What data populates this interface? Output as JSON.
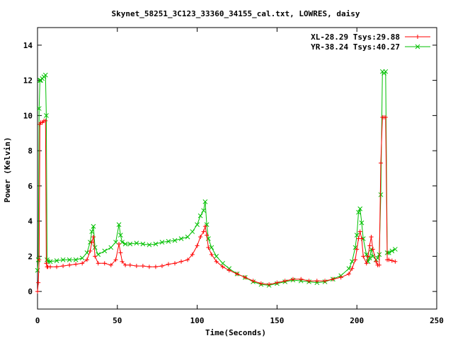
{
  "chart_data": {
    "type": "line",
    "title": "Skynet_58251_3C123_33360_34155_cal.txt, LOWRES, daisy",
    "xlabel": "Time(Seconds)",
    "ylabel": "Power (Kelvin)",
    "xlim": [
      0,
      250
    ],
    "ylim": [
      -1,
      15
    ],
    "xticks": [
      0,
      50,
      100,
      150,
      200,
      250
    ],
    "yticks": [
      0,
      2,
      4,
      6,
      8,
      10,
      12,
      14
    ],
    "grid": false,
    "legend": "top-right",
    "series": [
      {
        "name": "XL-28.29 Tsys:29.88",
        "color": "#ff0000",
        "marker": "plus",
        "x": [
          0,
          0.5,
          1,
          1.5,
          2,
          3,
          4,
          5,
          5.5,
          6,
          6.5,
          8,
          12,
          16,
          20,
          24,
          28,
          31,
          33,
          34,
          35,
          36,
          38,
          42,
          46,
          49,
          51,
          52,
          53,
          55,
          58,
          62,
          66,
          70,
          74,
          78,
          82,
          86,
          90,
          94,
          97,
          100,
          102,
          104,
          105,
          106,
          107,
          109,
          112,
          116,
          120,
          125,
          130,
          135,
          140,
          145,
          150,
          155,
          160,
          165,
          170,
          175,
          180,
          185,
          190,
          195,
          197,
          199,
          200,
          201,
          202,
          203,
          204,
          206,
          207,
          208,
          209,
          210,
          212,
          213,
          214,
          215,
          216,
          217,
          218,
          219,
          220,
          222,
          224
        ],
        "y": [
          0,
          0.5,
          1.8,
          9.5,
          9.6,
          9.6,
          9.7,
          9.7,
          1.6,
          1.4,
          1.4,
          1.4,
          1.4,
          1.45,
          1.5,
          1.55,
          1.6,
          1.8,
          2.3,
          2.8,
          3.1,
          2.0,
          1.6,
          1.6,
          1.5,
          1.8,
          2.7,
          2.2,
          1.7,
          1.5,
          1.5,
          1.45,
          1.45,
          1.4,
          1.4,
          1.45,
          1.55,
          1.6,
          1.7,
          1.8,
          2.1,
          2.6,
          3.1,
          3.4,
          3.7,
          3.2,
          2.5,
          2.1,
          1.7,
          1.4,
          1.2,
          1.0,
          0.8,
          0.6,
          0.45,
          0.4,
          0.5,
          0.6,
          0.7,
          0.7,
          0.6,
          0.6,
          0.6,
          0.7,
          0.8,
          1.0,
          1.3,
          1.8,
          2.4,
          3.0,
          3.4,
          3.0,
          2.0,
          1.6,
          2.0,
          2.6,
          3.1,
          2.4,
          1.7,
          1.5,
          1.5,
          7.3,
          9.9,
          9.9,
          9.9,
          1.8,
          1.8,
          1.75,
          1.7
        ]
      },
      {
        "name": "YR-38.24 Tsys:40.27",
        "color": "#00c000",
        "marker": "cross",
        "x": [
          0,
          0.5,
          1,
          1.5,
          2,
          3,
          4,
          5,
          5.5,
          6,
          6.5,
          8,
          12,
          16,
          20,
          24,
          28,
          31,
          33,
          34,
          35,
          36,
          38,
          42,
          46,
          49,
          51,
          52,
          53,
          55,
          58,
          62,
          66,
          70,
          74,
          78,
          82,
          86,
          90,
          94,
          97,
          100,
          102,
          104,
          105,
          106,
          107,
          109,
          112,
          116,
          120,
          125,
          130,
          135,
          140,
          145,
          150,
          155,
          160,
          165,
          170,
          175,
          180,
          185,
          190,
          195,
          197,
          199,
          200,
          201,
          202,
          203,
          204,
          206,
          207,
          208,
          209,
          210,
          212,
          213,
          214,
          215,
          216,
          217,
          218,
          219,
          220,
          222,
          224
        ],
        "y": [
          1.2,
          1.8,
          10.4,
          12.0,
          12.0,
          12.1,
          12.2,
          12.3,
          10.0,
          1.8,
          1.7,
          1.7,
          1.75,
          1.8,
          1.8,
          1.8,
          1.9,
          2.2,
          2.8,
          3.4,
          3.7,
          2.5,
          2.1,
          2.3,
          2.5,
          2.8,
          3.8,
          3.2,
          2.8,
          2.7,
          2.7,
          2.75,
          2.7,
          2.65,
          2.7,
          2.8,
          2.85,
          2.9,
          3.0,
          3.1,
          3.4,
          3.8,
          4.3,
          4.6,
          5.1,
          3.8,
          3.0,
          2.5,
          2.0,
          1.6,
          1.3,
          1.0,
          0.8,
          0.55,
          0.4,
          0.35,
          0.45,
          0.55,
          0.65,
          0.6,
          0.55,
          0.5,
          0.55,
          0.7,
          0.9,
          1.3,
          1.7,
          2.5,
          3.2,
          4.5,
          4.7,
          3.9,
          3.0,
          2.1,
          1.7,
          1.9,
          2.4,
          2.0,
          1.8,
          1.9,
          2.1,
          5.5,
          12.5,
          12.4,
          12.5,
          2.2,
          2.2,
          2.3,
          2.4
        ]
      }
    ]
  }
}
